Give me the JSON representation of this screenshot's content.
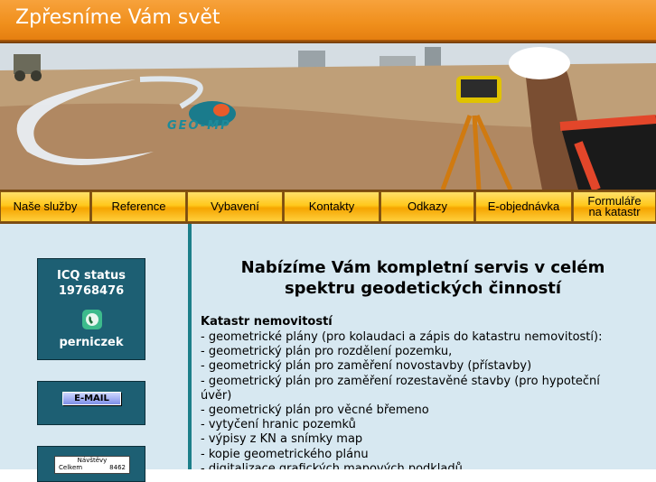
{
  "header": {
    "title": "Zpřesníme Vám svět"
  },
  "banner": {
    "logo_text": "GEO-MP"
  },
  "nav": {
    "items": [
      {
        "label": "Naše služby"
      },
      {
        "label": "Reference"
      },
      {
        "label": "Vybavení"
      },
      {
        "label": "Kontakty"
      },
      {
        "label": "Odkazy"
      },
      {
        "label": "E-objednávka"
      },
      {
        "label_line1": "Formuláře",
        "label_line2": "na katastr"
      }
    ]
  },
  "sidebar": {
    "icq": {
      "line1": "ICQ status",
      "line2": "19768476",
      "name": "perniczek"
    },
    "email": {
      "label": "E-MAIL"
    },
    "counter": {
      "title": "Návštěvy",
      "row_label": "Celkem",
      "row_value": "8462"
    }
  },
  "main": {
    "headline_line1": "Nabízíme Vám kompletní servis v celém",
    "headline_line2": "spektru geodetických činností",
    "section_title": "Katastr nemovitostí",
    "items": [
      "- geometrické plány (pro kolaudaci a zápis do katastru nemovitostí):",
      "- geometrický plán pro rozdělení pozemku,",
      "- geometrický plán pro zaměření novostavby (přístavby)",
      "- geometrický plán pro zaměření rozestavěné stavby (pro hypoteční úvěr)",
      "- geometrický plán pro věcné břemeno",
      "- vytyčení hranic pozemků",
      "- výpisy z KN a snímky map",
      "- kopie geometrického plánu",
      "- digitalizace grafických mapových podkladů"
    ]
  },
  "colors": {
    "header_orange": "#f08f1c",
    "nav_gold": "#ffc81c",
    "content_bg": "#d7e8f1",
    "sidebar_box": "#1d5f73",
    "divider_teal": "#1c7f8a"
  }
}
